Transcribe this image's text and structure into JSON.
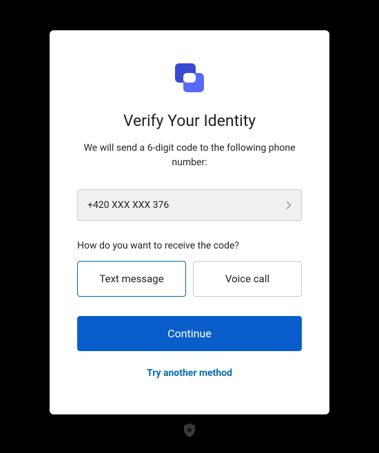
{
  "title": "Verify Your Identity",
  "subtitle": "We will send a 6-digit code to the following phone number:",
  "phone_number": "+420 XXX XXX 376",
  "question": "How do you want to receive the code?",
  "options": {
    "text_message": "Text message",
    "voice_call": "Voice call"
  },
  "continue_label": "Continue",
  "alt_method_label": "Try another method"
}
